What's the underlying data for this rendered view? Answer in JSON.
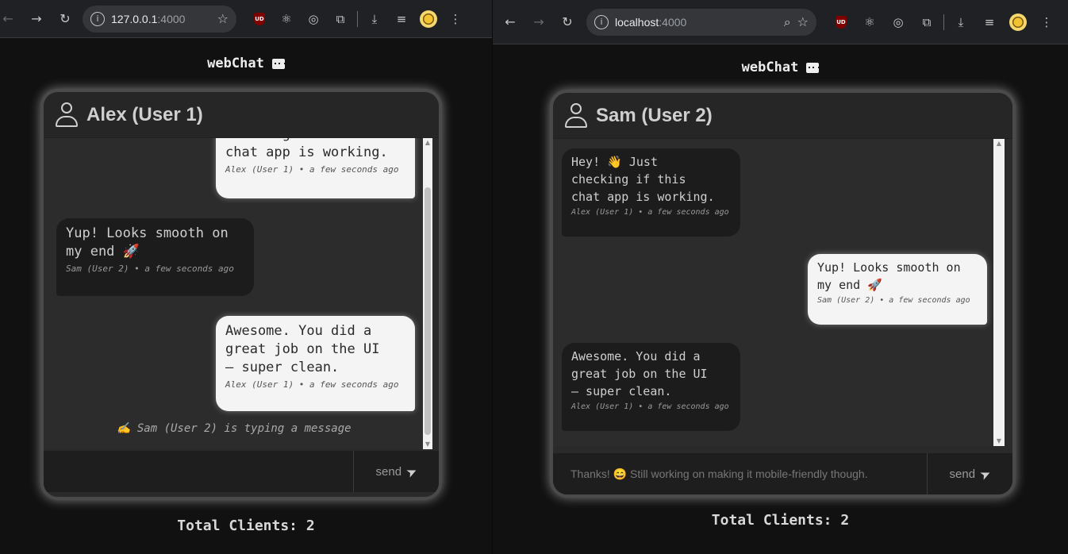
{
  "app_title": "webChat",
  "total_label": "Total Clients: 2",
  "left": {
    "url_host": "127.0.0.1",
    "url_port": ":4000",
    "user_name": "Alex (User 1)",
    "messages": [
      {
        "text": "checking if this\nchat app is working.",
        "meta": "Alex (User 1) • a few seconds ago"
      },
      {
        "text": "Yup! Looks smooth on\nmy end 🚀",
        "meta": "Sam (User 2) • a few seconds ago"
      },
      {
        "text": "Awesome. You did a\ngreat job on the UI\n— super clean.",
        "meta": "Alex (User 1) • a few seconds ago"
      }
    ],
    "typing": "✍ Sam (User 2) is typing a message",
    "composer_text": "",
    "send_label": "send"
  },
  "right": {
    "url_host": "localhost",
    "url_port": ":4000",
    "user_name": "Sam (User 2)",
    "messages": [
      {
        "text": "Hey! 👋 Just\nchecking if this\nchat app is working.",
        "meta": "Alex (User 1) • a few seconds ago"
      },
      {
        "text": "Yup! Looks smooth on\nmy end 🚀",
        "meta": "Sam (User 2) • a few seconds ago"
      },
      {
        "text": "Awesome. You did a\ngreat job on the UI\n— super clean.",
        "meta": "Alex (User 1) • a few seconds ago"
      }
    ],
    "composer_text": "Thanks! 😄 Still working on making it mobile-friendly though.",
    "send_label": "send"
  }
}
